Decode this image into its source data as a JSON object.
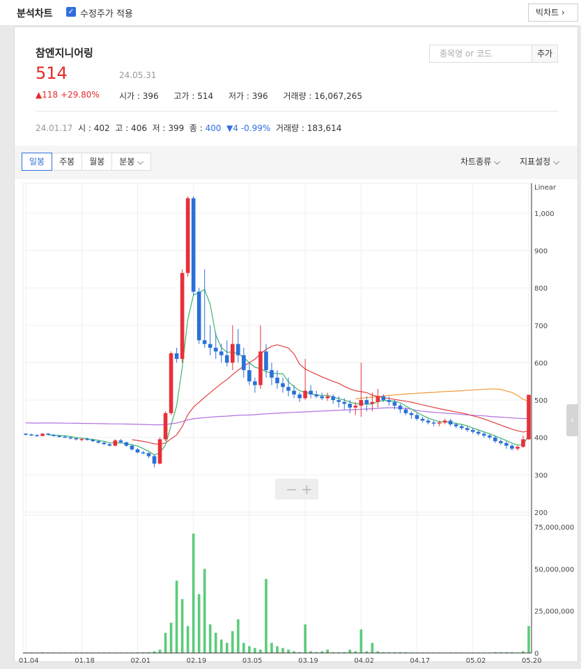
{
  "header": {
    "title": "분석차트",
    "adjusted_label": "수정주가 적용",
    "big_chart_label": "빅차트 ›"
  },
  "stock": {
    "name": "참엔지니어링",
    "price": "514",
    "date": "24.05.31",
    "change": "▲118 +29.80%",
    "open": "시가 : 396",
    "high": "고가 : 514",
    "low": "저가 : 396",
    "volume": "거래량 : 16,067,265"
  },
  "search": {
    "placeholder": "종목명 or 코드",
    "add_label": "추가"
  },
  "day_info": {
    "date": "24.01.17",
    "open": "시 : 402",
    "high": "고 : 406",
    "low": "저 : 399",
    "close_label": "종 :",
    "close_value": "400",
    "change": "▼4 -0.99%",
    "volume": "거래량 : 183,614"
  },
  "toolbar": {
    "tabs": [
      "일봉",
      "주봉",
      "월봉",
      "분봉 ⌵"
    ],
    "chart_type": "차트종류 ⌵",
    "indicator": "지표설정 ⌵"
  },
  "colors": {
    "up": "#e8303a",
    "down": "#2a70d8",
    "volume": "#5ccb7a",
    "ma5": "#3cb46e",
    "ma20": "#e04040",
    "ma60": "#f29a3b",
    "ma120": "#b070e0"
  },
  "chart_data": {
    "type": "candlestick",
    "scale_label": "Linear",
    "price_ylim": [
      200,
      1080
    ],
    "price_ticks": [
      "1,000",
      "900",
      "800",
      "700",
      "600",
      "500",
      "400",
      "300",
      "200"
    ],
    "volume_ticks": [
      "75,000,000",
      "50,000,000",
      "25,000,000",
      "0"
    ],
    "volume_ylim": [
      0,
      82000000
    ],
    "x_labels": [
      {
        "label": "01.04",
        "index": 0
      },
      {
        "label": "01.18",
        "index": 10
      },
      {
        "label": "02.01",
        "index": 20
      },
      {
        "label": "02.19",
        "index": 30
      },
      {
        "label": "03.05",
        "index": 40
      },
      {
        "label": "03.19",
        "index": 50
      },
      {
        "label": "04.02",
        "index": 60
      },
      {
        "label": "04.17",
        "index": 70
      },
      {
        "label": "05.02",
        "index": 80
      },
      {
        "label": "05.20",
        "index": 90
      }
    ],
    "candles": [
      [
        410,
        412,
        405,
        408
      ],
      [
        408,
        410,
        404,
        406
      ],
      [
        406,
        409,
        402,
        404
      ],
      [
        404,
        412,
        403,
        410
      ],
      [
        410,
        412,
        405,
        407
      ],
      [
        407,
        409,
        402,
        404
      ],
      [
        404,
        407,
        400,
        402
      ],
      [
        402,
        406,
        399,
        400
      ],
      [
        400,
        402,
        395,
        398
      ],
      [
        398,
        400,
        392,
        395
      ],
      [
        395,
        398,
        390,
        396
      ],
      [
        396,
        400,
        392,
        394
      ],
      [
        394,
        396,
        388,
        390
      ],
      [
        390,
        392,
        384,
        386
      ],
      [
        386,
        390,
        380,
        382
      ],
      [
        382,
        385,
        376,
        378
      ],
      [
        378,
        395,
        376,
        392
      ],
      [
        392,
        396,
        385,
        387
      ],
      [
        387,
        389,
        375,
        378
      ],
      [
        378,
        380,
        365,
        368
      ],
      [
        368,
        372,
        358,
        360
      ],
      [
        360,
        364,
        355,
        358
      ],
      [
        358,
        360,
        345,
        350
      ],
      [
        350,
        354,
        320,
        330
      ],
      [
        330,
        400,
        328,
        395
      ],
      [
        395,
        470,
        390,
        465
      ],
      [
        465,
        630,
        460,
        625
      ],
      [
        625,
        640,
        600,
        610
      ],
      [
        610,
        850,
        600,
        840
      ],
      [
        840,
        1045,
        830,
        1040
      ],
      [
        1040,
        1045,
        780,
        790
      ],
      [
        790,
        800,
        650,
        660
      ],
      [
        660,
        850,
        640,
        650
      ],
      [
        650,
        700,
        620,
        640
      ],
      [
        640,
        680,
        610,
        630
      ],
      [
        630,
        650,
        600,
        620
      ],
      [
        620,
        660,
        590,
        600
      ],
      [
        600,
        700,
        580,
        650
      ],
      [
        650,
        690,
        600,
        620
      ],
      [
        620,
        640,
        560,
        580
      ],
      [
        580,
        600,
        540,
        550
      ],
      [
        550,
        560,
        520,
        540
      ],
      [
        540,
        700,
        530,
        630
      ],
      [
        630,
        650,
        560,
        580
      ],
      [
        580,
        600,
        540,
        560
      ],
      [
        560,
        580,
        530,
        545
      ],
      [
        545,
        560,
        520,
        535
      ],
      [
        535,
        560,
        510,
        525
      ],
      [
        525,
        540,
        505,
        515
      ],
      [
        515,
        520,
        495,
        505
      ],
      [
        505,
        610,
        500,
        525
      ],
      [
        525,
        540,
        505,
        515
      ],
      [
        515,
        525,
        505,
        510
      ],
      [
        510,
        520,
        500,
        505
      ],
      [
        505,
        520,
        498,
        510
      ],
      [
        510,
        515,
        490,
        500
      ],
      [
        500,
        510,
        480,
        495
      ],
      [
        495,
        505,
        475,
        490
      ],
      [
        490,
        500,
        465,
        480
      ],
      [
        480,
        495,
        460,
        485
      ],
      [
        485,
        600,
        455,
        500
      ],
      [
        500,
        510,
        470,
        490
      ],
      [
        490,
        520,
        470,
        495
      ],
      [
        495,
        530,
        480,
        510
      ],
      [
        510,
        515,
        495,
        500
      ],
      [
        500,
        510,
        485,
        495
      ],
      [
        495,
        500,
        475,
        485
      ],
      [
        485,
        490,
        465,
        475
      ],
      [
        475,
        480,
        460,
        465
      ],
      [
        465,
        470,
        450,
        460
      ],
      [
        460,
        465,
        445,
        450
      ],
      [
        450,
        455,
        440,
        445
      ],
      [
        445,
        450,
        435,
        440
      ],
      [
        440,
        445,
        430,
        438
      ],
      [
        438,
        445,
        430,
        440
      ],
      [
        440,
        450,
        435,
        445
      ],
      [
        445,
        450,
        430,
        435
      ],
      [
        435,
        440,
        425,
        430
      ],
      [
        430,
        435,
        420,
        425
      ],
      [
        425,
        430,
        415,
        420
      ],
      [
        420,
        425,
        410,
        415
      ],
      [
        415,
        420,
        405,
        410
      ],
      [
        410,
        415,
        400,
        405
      ],
      [
        405,
        410,
        395,
        400
      ],
      [
        400,
        405,
        385,
        390
      ],
      [
        390,
        395,
        380,
        385
      ],
      [
        385,
        390,
        370,
        378
      ],
      [
        378,
        382,
        365,
        370
      ],
      [
        370,
        378,
        365,
        375
      ],
      [
        375,
        405,
        372,
        395
      ],
      [
        395,
        515,
        394,
        514
      ]
    ],
    "volume": [
      0.3,
      0.3,
      0.3,
      0.4,
      0.3,
      0.3,
      0.3,
      0.3,
      0.3,
      0.3,
      0.3,
      0.3,
      0.3,
      0.3,
      0.3,
      0.3,
      0.3,
      0.3,
      0.3,
      0.3,
      0.4,
      0.4,
      0.5,
      1.0,
      2.0,
      12,
      18,
      43,
      32,
      16,
      71,
      35,
      50,
      17,
      12,
      8,
      6,
      13,
      20,
      6,
      4,
      3,
      2,
      44,
      6,
      4,
      3,
      2,
      1,
      0.5,
      17,
      1,
      0.5,
      1,
      2,
      0.5,
      0.5,
      0.5,
      2,
      1,
      14,
      1,
      6,
      1,
      0.5,
      0.5,
      0.5,
      0.5,
      0.5,
      0.3,
      0.3,
      0.3,
      0.3,
      0.3,
      0.3,
      0.3,
      0.3,
      0.3,
      0.3,
      0.3,
      0.3,
      0.3,
      0.3,
      0.3,
      0.5,
      0.5,
      0.5,
      0.5,
      0.3,
      1,
      16
    ],
    "ma5": [],
    "ma20": [],
    "ma60": [],
    "ma120": []
  }
}
